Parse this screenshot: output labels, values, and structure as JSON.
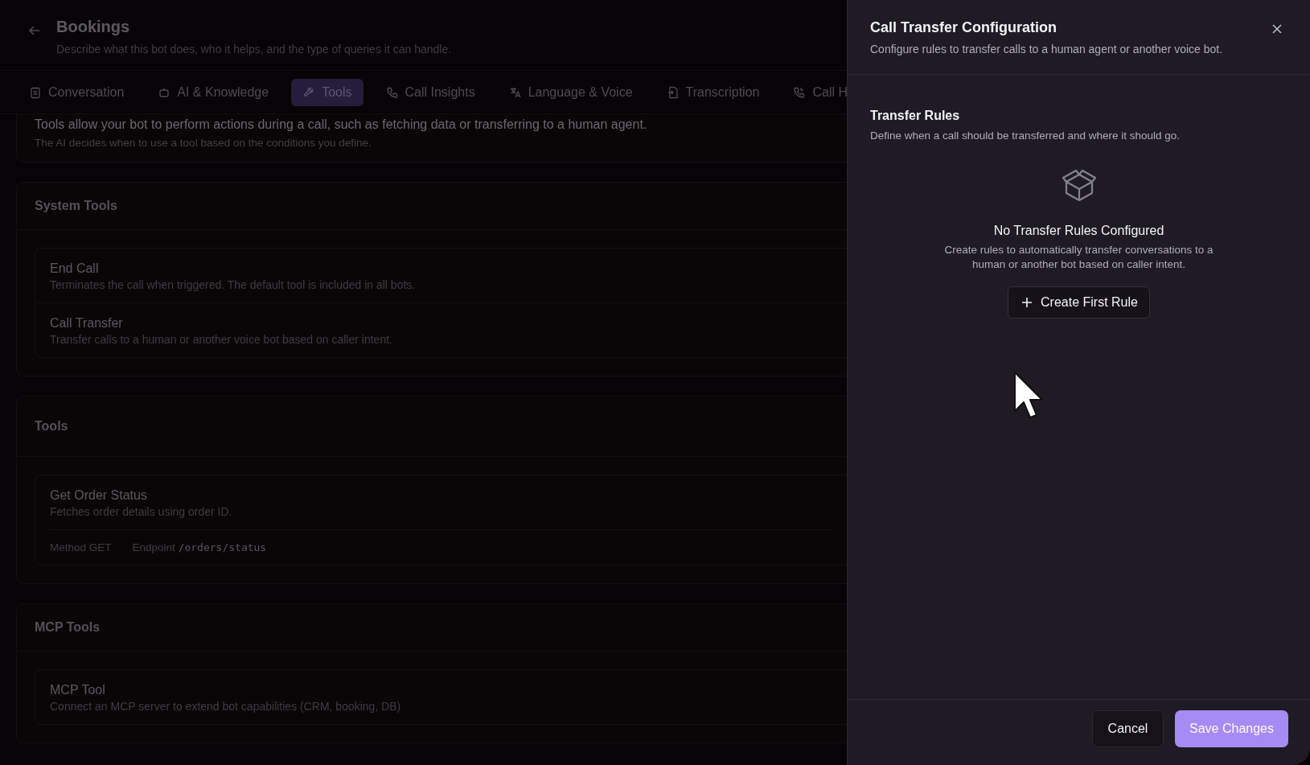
{
  "header": {
    "title": "Bookings",
    "description": "Describe what this bot does, who it helps, and the type of queries it can handle."
  },
  "tabs": [
    {
      "label": "Conversation",
      "selected": false
    },
    {
      "label": "AI & Knowledge",
      "selected": false
    },
    {
      "label": "Tools",
      "selected": true
    },
    {
      "label": "Call Insights",
      "selected": false
    },
    {
      "label": "Language & Voice",
      "selected": false
    },
    {
      "label": "Transcription",
      "selected": false
    },
    {
      "label": "Call H",
      "selected": false
    }
  ],
  "intro": {
    "heading": "Tools allow your bot to perform actions during a call, such as fetching data or transferring to a human agent.",
    "note": "The AI decides when to use a tool based on the conditions you define."
  },
  "sections": [
    {
      "title": "System Tools",
      "tools": [
        {
          "name": "End Call",
          "description": "Terminates the call when triggered. The default tool is included in all bots."
        },
        {
          "name": "Call Transfer",
          "description": "Transfer calls to a human or another voice bot based on caller intent."
        }
      ]
    },
    {
      "title": "Tools",
      "tools": [
        {
          "name": "Get Order Status",
          "description": "Fetches order details using order ID.",
          "method_label": "Method",
          "method": "GET",
          "endpoint_label": "Endpoint",
          "endpoint": "/orders/status"
        }
      ]
    },
    {
      "title": "MCP Tools",
      "tools": [
        {
          "name": "MCP Tool",
          "description": "Connect an MCP server to extend bot capabilities (CRM, booking, DB)"
        }
      ]
    }
  ],
  "panel": {
    "title": "Call Transfer Configuration",
    "description": "Configure rules to transfer calls to a human agent or another voice bot.",
    "section_title": "Transfer Rules",
    "section_description": "Define when a call should be transferred and where it should go.",
    "empty_title": "No Transfer Rules Configured",
    "empty_text": "Create rules to automatically transfer conversations to a human or another bot based on caller intent.",
    "create_button": "Create First Rule",
    "cancel_button": "Cancel",
    "save_button": "Save Changes"
  }
}
